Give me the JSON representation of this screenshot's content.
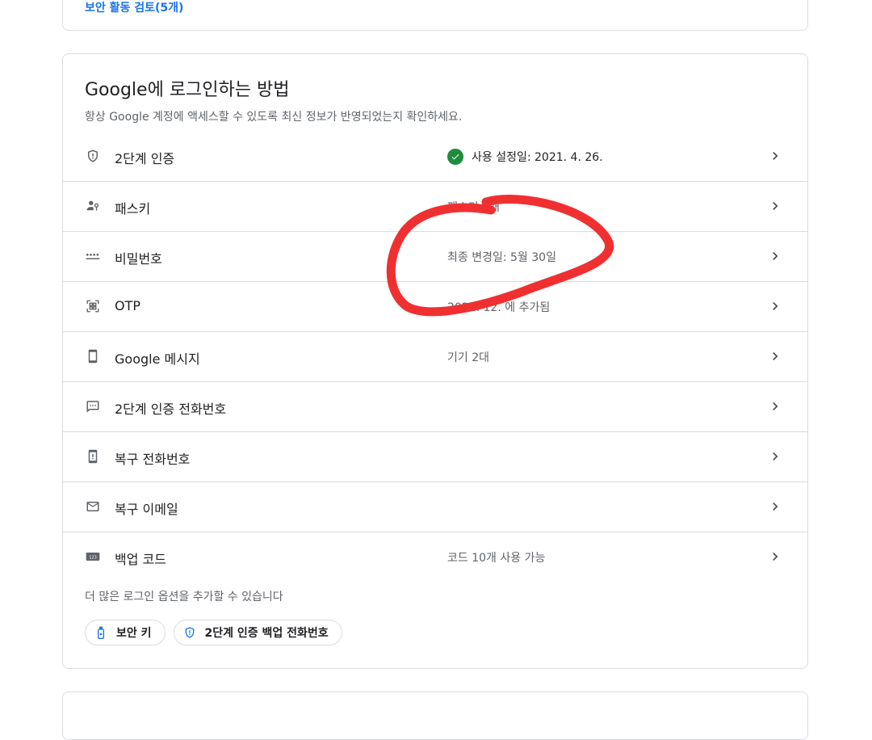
{
  "prev_section": {
    "link_label": "보안 활동 검토(5개)"
  },
  "signin": {
    "title": "Google에 로그인하는 방법",
    "subtitle": "항상 Google 계정에 액세스할 수 있도록 최신 정보가 반영되었는지 확인하세요.",
    "rows": [
      {
        "icon": "shield-icon",
        "label": "2단계 인증",
        "value": "사용 설정일: 2021. 4. 26.",
        "status_icon": "check-circle-icon"
      },
      {
        "icon": "passkey-icon",
        "label": "패스키",
        "value": "패스키 2개"
      },
      {
        "icon": "password-dots-icon",
        "label": "비밀번호",
        "value": "최종 변경일: 5월 30일"
      },
      {
        "icon": "qr-code-icon",
        "label": "OTP",
        "value": "2022. 12. 에 추가됨"
      },
      {
        "icon": "smartphone-icon",
        "label": "Google 메시지",
        "value": "기기 2대"
      },
      {
        "icon": "sms-icon",
        "label": "2단계 인증 전화번호",
        "value": ""
      },
      {
        "icon": "phone-alert-icon",
        "label": "복구 전화번호",
        "value": ""
      },
      {
        "icon": "mail-icon",
        "label": "복구 이메일",
        "value": ""
      },
      {
        "icon": "backup-codes-icon",
        "label": "백업 코드",
        "value": "코드 10개 사용 가능"
      }
    ],
    "more_options_text": "더 많은 로그인 옵션을 추가할 수 있습니다",
    "chips": [
      {
        "icon": "security-key-icon",
        "label": "보안 키"
      },
      {
        "icon": "shield-icon",
        "label": "2단계 인증 백업 전화번호"
      }
    ]
  },
  "colors": {
    "accent": "#1a73e8",
    "success": "#1e8e3e",
    "annotation": "#f03030"
  }
}
